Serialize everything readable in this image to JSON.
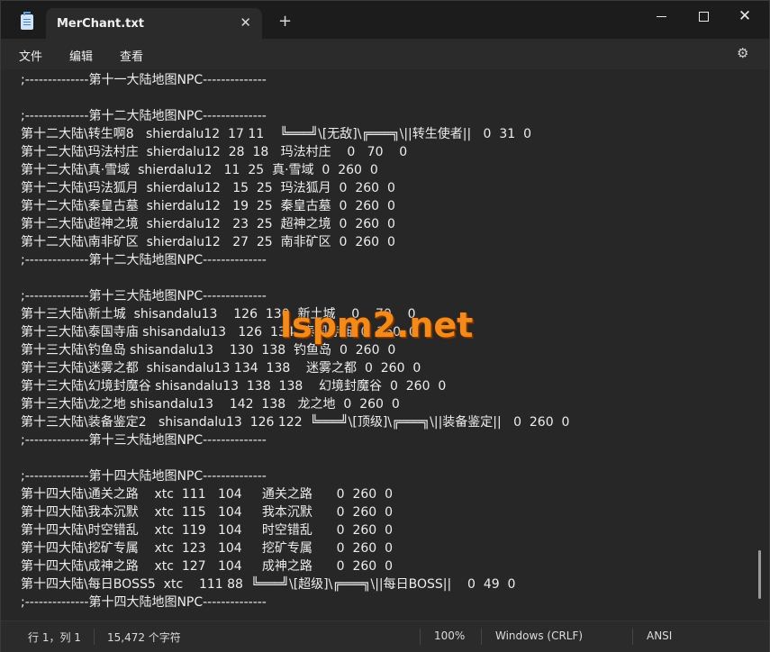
{
  "window": {
    "tab_title": "MerChant.txt",
    "tab_close_glyph": "✕",
    "new_tab_glyph": "+",
    "close_glyph": "✕"
  },
  "menu": {
    "file": "文件",
    "edit": "编辑",
    "view": "查看"
  },
  "editor": {
    "cut_top_line": "                                                                 ",
    "lines": [
      ";--------------第十一大陆地图NPC--------------",
      "",
      ";--------------第十二大陆地图NPC--------------",
      "第十二大陆\\转生啊8   shierdalu12  17 11    ╚═══╝\\[无敌]\\╔═══╗\\||转生使者||   0  31  0",
      "第十二大陆\\玛法村庄  shierdalu12  28  18   玛法村庄    0   70    0",
      "第十二大陆\\真·雪域  shierdalu12   11  25  真·雪域  0  260  0",
      "第十二大陆\\玛法狐月  shierdalu12   15  25  玛法狐月  0  260  0",
      "第十二大陆\\秦皇古墓  shierdalu12   19  25  秦皇古墓  0  260  0",
      "第十二大陆\\超神之境  shierdalu12   23  25  超神之境  0  260  0",
      "第十二大陆\\南非矿区  shierdalu12   27  25  南非矿区  0  260  0",
      ";--------------第十二大陆地图NPC--------------",
      "",
      ";--------------第十三大陆地图NPC--------------",
      "第十三大陆\\新土城  shisandalu13    126  130  新土城    0    70    0",
      "第十三大陆\\泰国寺庙 shisandalu13   126  134  泰国寺庙  0  260  0",
      "第十三大陆\\钓鱼岛 shisandalu13    130  138  钓鱼岛  0  260  0",
      "第十三大陆\\迷雾之都  shisandalu13 134  138    迷雾之都  0  260  0",
      "第十三大陆\\幻境封魔谷 shisandalu13  138  138    幻境封魔谷  0  260  0",
      "第十三大陆\\龙之地 shisandalu13    142  138   龙之地  0  260  0",
      "第十三大陆\\装备鉴定2   shisandalu13  126 122  ╚═══╝\\[顶级]\\╔═══╗\\||装备鉴定||   0  260  0",
      ";--------------第十三大陆地图NPC--------------",
      "",
      ";--------------第十四大陆地图NPC--------------",
      "第十四大陆\\通关之路    xtc  111   104     通关之路      0  260  0",
      "第十四大陆\\我本沉默    xtc  115   104     我本沉默      0  260  0",
      "第十四大陆\\时空错乱    xtc  119   104     时空错乱      0  260  0",
      "第十四大陆\\挖矿专属    xtc  123   104     挖矿专属      0  260  0",
      "第十四大陆\\成神之路    xtc  127   104     成神之路      0  260  0",
      "第十四大陆\\每日BOSS5  xtc    111 88  ╚═══╝\\[超级]\\╔═══╗\\||每日BOSS||    0  49  0",
      ";--------------第十四大陆地图NPC--------------"
    ]
  },
  "watermark": "lspm2.net",
  "status": {
    "position": "行 1，列 1",
    "char_count": "15,472 个字符",
    "zoom": "100%",
    "line_ending": "Windows (CRLF)",
    "encoding": "ANSI"
  },
  "icons": {
    "app": "notepad-icon",
    "settings": "gear-icon"
  }
}
